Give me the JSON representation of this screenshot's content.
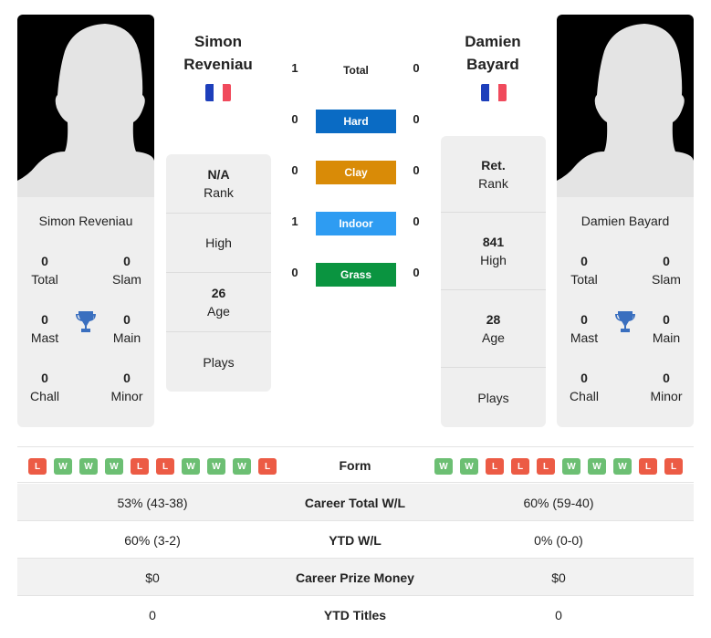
{
  "player1": {
    "name_line1": "Simon",
    "name_line2": "Reveniau",
    "card_name": "Simon Reveniau",
    "country_flag": "france-flag",
    "titles": {
      "total": {
        "value": "0",
        "label": "Total"
      },
      "slam": {
        "value": "0",
        "label": "Slam"
      },
      "mast": {
        "value": "0",
        "label": "Mast"
      },
      "main": {
        "value": "0",
        "label": "Main"
      },
      "chall": {
        "value": "0",
        "label": "Chall"
      },
      "minor": {
        "value": "0",
        "label": "Minor"
      }
    },
    "info": {
      "rank": {
        "value": "N/A",
        "label": "Rank"
      },
      "high": {
        "value": "",
        "label": "High"
      },
      "age": {
        "value": "26",
        "label": "Age"
      },
      "plays": {
        "value": "",
        "label": "Plays"
      }
    },
    "form": [
      "L",
      "W",
      "W",
      "W",
      "L",
      "L",
      "W",
      "W",
      "W",
      "L"
    ]
  },
  "player2": {
    "name_line1": "Damien",
    "name_line2": "Bayard",
    "card_name": "Damien Bayard",
    "country_flag": "france-flag",
    "titles": {
      "total": {
        "value": "0",
        "label": "Total"
      },
      "slam": {
        "value": "0",
        "label": "Slam"
      },
      "mast": {
        "value": "0",
        "label": "Mast"
      },
      "main": {
        "value": "0",
        "label": "Main"
      },
      "chall": {
        "value": "0",
        "label": "Chall"
      },
      "minor": {
        "value": "0",
        "label": "Minor"
      }
    },
    "info": {
      "rank": {
        "value": "Ret.",
        "label": "Rank"
      },
      "high": {
        "value": "841",
        "label": "High"
      },
      "age": {
        "value": "28",
        "label": "Age"
      },
      "plays": {
        "value": "",
        "label": "Plays"
      }
    },
    "form": [
      "W",
      "W",
      "L",
      "L",
      "L",
      "W",
      "W",
      "W",
      "L",
      "L"
    ]
  },
  "h2h": {
    "total": {
      "label": "Total",
      "p1": "1",
      "p2": "0"
    },
    "surfaces": [
      {
        "label": "Hard",
        "p1": "0",
        "p2": "0",
        "color": "#0a6bc4"
      },
      {
        "label": "Clay",
        "p1": "0",
        "p2": "0",
        "color": "#d98b07"
      },
      {
        "label": "Indoor",
        "p1": "1",
        "p2": "0",
        "color": "#2e9cf2"
      },
      {
        "label": "Grass",
        "p1": "0",
        "p2": "0",
        "color": "#0a9440"
      }
    ]
  },
  "form_label": "Form",
  "stats": [
    {
      "label": "Career Total W/L",
      "p1": "53% (43-38)",
      "p2": "60% (59-40)"
    },
    {
      "label": "YTD W/L",
      "p1": "60% (3-2)",
      "p2": "0% (0-0)"
    },
    {
      "label": "Career Prize Money",
      "p1": "$0",
      "p2": "$0"
    },
    {
      "label": "YTD Titles",
      "p1": "0",
      "p2": "0"
    }
  ],
  "colors": {
    "win": "#6cbf73",
    "loss": "#ec5b45",
    "trophy": "#3a6fbf"
  }
}
